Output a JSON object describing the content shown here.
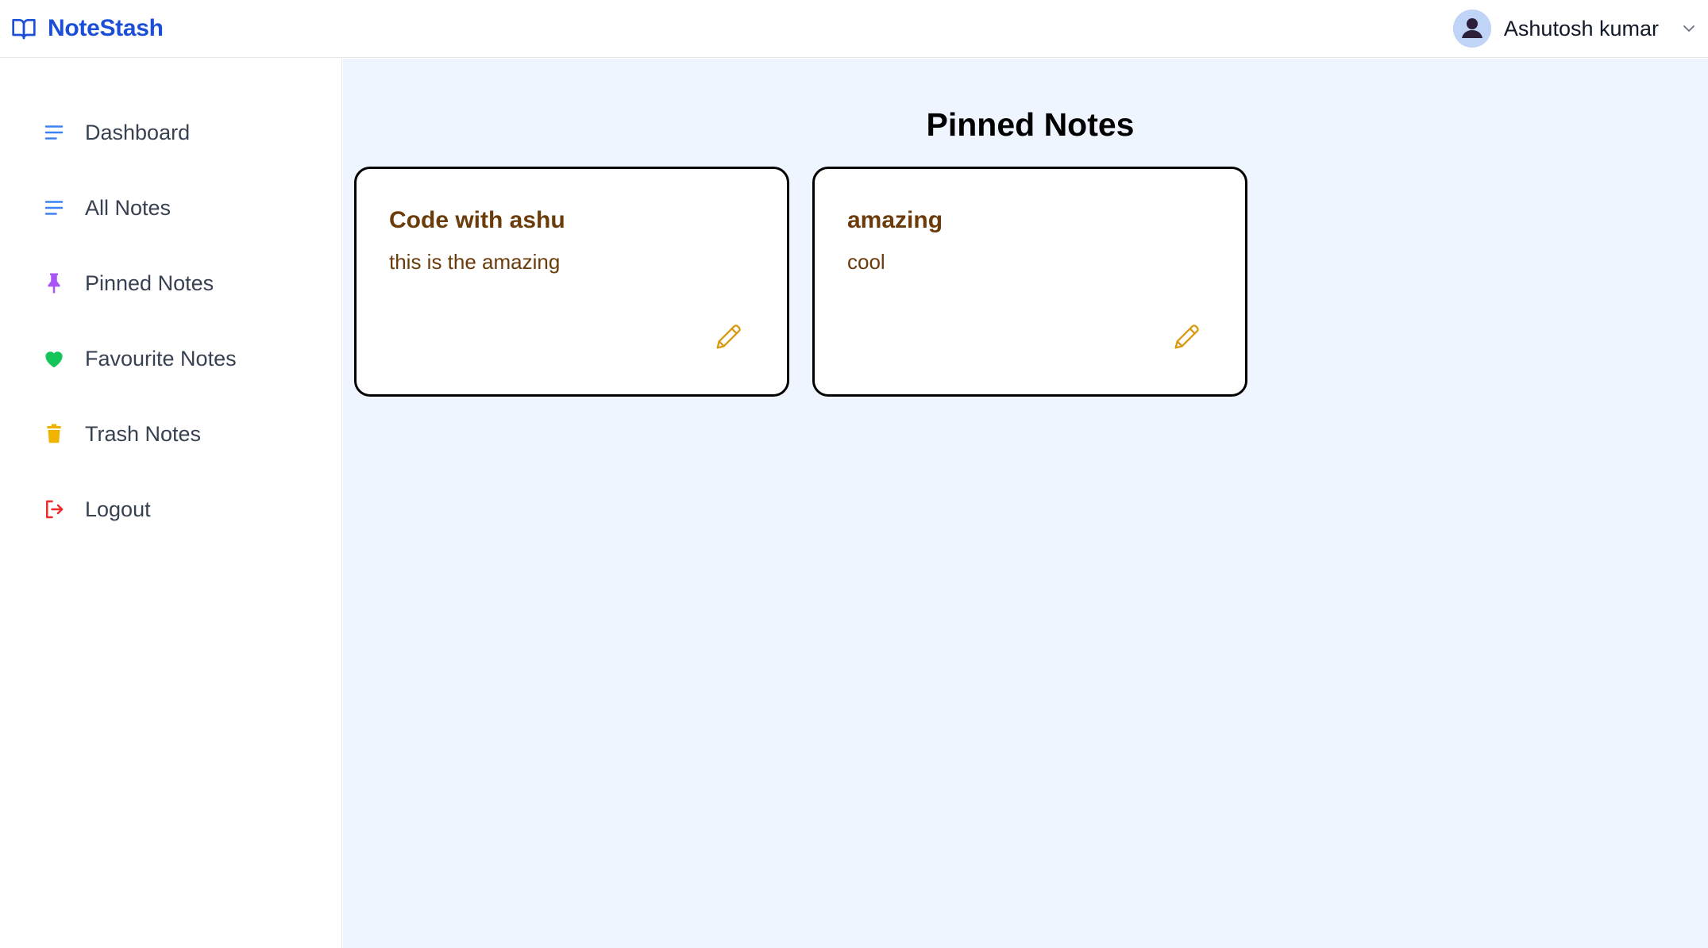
{
  "header": {
    "brand_name": "NoteStash",
    "brand_icon": "book-open-icon",
    "user_name": "Ashutosh kumar",
    "avatar_icon": "user-avatar-icon",
    "dropdown_icon": "chevron-down-icon"
  },
  "sidebar": {
    "items": [
      {
        "label": "Dashboard",
        "icon": "lines-icon",
        "color": "#3b82f6"
      },
      {
        "label": "All Notes",
        "icon": "lines-icon",
        "color": "#3b82f6"
      },
      {
        "label": "Pinned Notes",
        "icon": "pin-icon",
        "color": "#a855f7"
      },
      {
        "label": "Favourite Notes",
        "icon": "heart-icon",
        "color": "#16c55a"
      },
      {
        "label": "Trash Notes",
        "icon": "trash-icon",
        "color": "#f0b400"
      },
      {
        "label": "Logout",
        "icon": "logout-icon",
        "color": "#ef2b2b"
      }
    ]
  },
  "main": {
    "title": "Pinned Notes",
    "notes": [
      {
        "title": "Code with ashu",
        "body": "this is the amazing",
        "edit_icon": "pencil-icon"
      },
      {
        "title": "amazing",
        "body": "cool",
        "edit_icon": "pencil-icon"
      }
    ]
  },
  "colors": {
    "brand": "#1d4ed8",
    "main_bg": "#eef5ff",
    "note_text": "#6b3b0a",
    "edit_icon": "#d99a12"
  }
}
